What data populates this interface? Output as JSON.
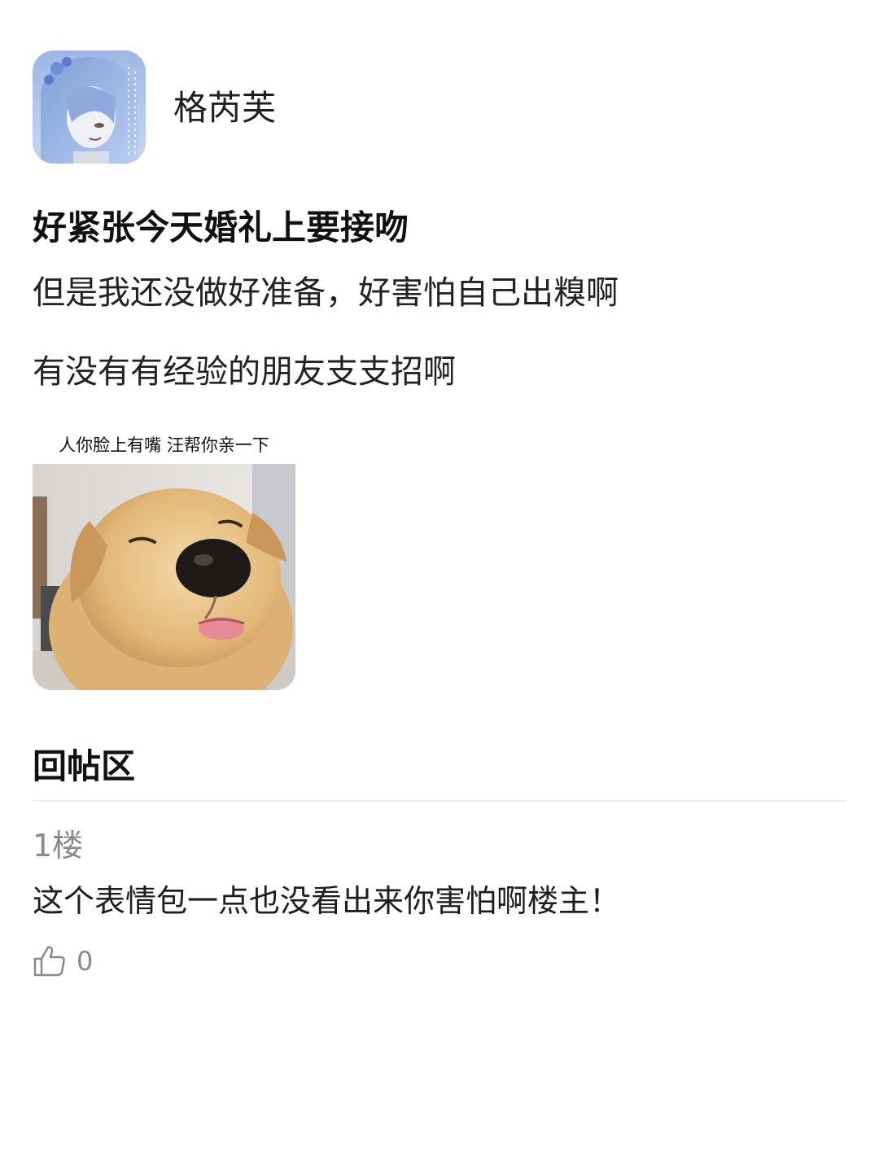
{
  "post": {
    "author": {
      "name": "格芮芙",
      "avatar_icon": "anime-avatar-icon"
    },
    "title": "好紧张今天婚礼上要接吻",
    "body_lines": [
      "但是我还没做好准备，好害怕自己出糗啊",
      "有没有有经验的朋友支支招啊"
    ],
    "meme": {
      "caption": "人你脸上有嘴 汪帮你亲一下",
      "icon": "puppy-photo"
    }
  },
  "replies": {
    "heading": "回帖区",
    "items": [
      {
        "floor": "1楼",
        "text": "这个表情包一点也没看出来你害怕啊楼主！",
        "like_icon": "thumbs-up-icon",
        "likes": "0"
      }
    ]
  },
  "colors": {
    "background": "#ffffff",
    "text_primary": "#1a1a1a",
    "text_muted": "#8a8a8a",
    "divider": "#eeeeee"
  }
}
